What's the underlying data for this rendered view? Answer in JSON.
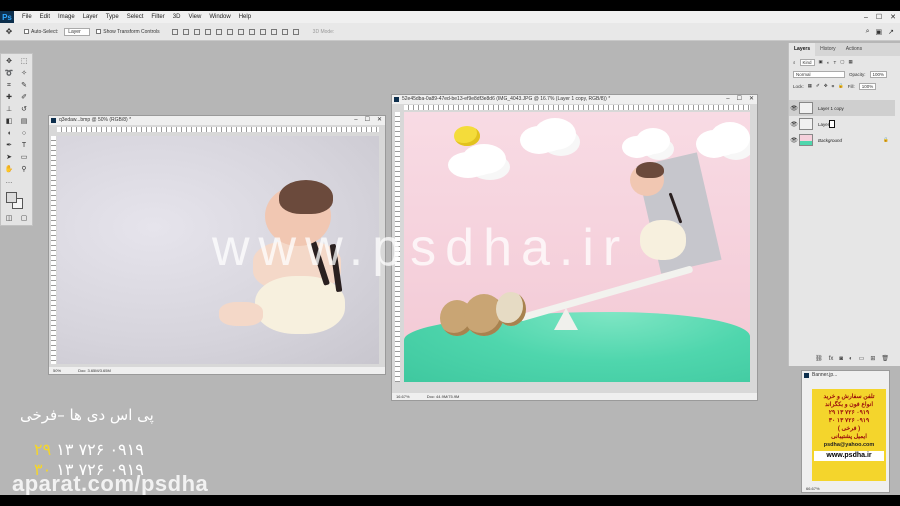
{
  "app": {
    "logo": "Ps",
    "menu": [
      "File",
      "Edit",
      "Image",
      "Layer",
      "Type",
      "Select",
      "Filter",
      "3D",
      "View",
      "Window",
      "Help"
    ],
    "window_controls": [
      "–",
      "☐",
      "✕"
    ]
  },
  "options": {
    "auto_select_label": "Auto-Select:",
    "auto_select_value": "Layer",
    "transform_label": "Show Transform Controls",
    "mode3d_label": "3D Mode:"
  },
  "doc1": {
    "title": "q3edaw...bmp @ 50% (RGB/8) *",
    "zoom": "50%",
    "doc_size": "Doc: 3.65M/3.65M",
    "buttons": [
      "–",
      "☐",
      "✕"
    ]
  },
  "doc2": {
    "title": "52e45dba-0a89-47ed-be13-ef9e8df3e8d6 (IMG_4043.JPG @ 16.7% (Layer 1 copy, RGB/8)) *",
    "zoom": "16.67%",
    "doc_size": "Doc: 44.9M/75.9M",
    "buttons": [
      "–",
      "☐",
      "✕"
    ],
    "ruler_v": [
      "0",
      "1",
      "2",
      "3",
      "4",
      "5",
      "6",
      "7",
      "8",
      "9",
      "10",
      "11",
      "12",
      "13",
      "14",
      "15",
      "16",
      "17",
      "18"
    ]
  },
  "watermark": "www.psdha.ir",
  "layers_panel": {
    "tabs": [
      "Layers",
      "History",
      "Actions"
    ],
    "kind_label": "Kind",
    "blend_mode": "Normal",
    "opacity_label": "Opacity:",
    "opacity_value": "100%",
    "lock_label": "Lock:",
    "fill_label": "Fill:",
    "fill_value": "100%",
    "layers": [
      {
        "name": "Layer 1 copy",
        "selected": true
      },
      {
        "name": "Layer 1",
        "selected": false
      },
      {
        "name": "Background",
        "selected": false
      }
    ],
    "footer_icons": [
      "fx",
      "link-icon",
      "mask-icon",
      "adjust-icon",
      "folder-icon",
      "new-layer-icon",
      "trash-icon"
    ]
  },
  "banner": {
    "title": "Banner.jp...",
    "zoom": "66.67%",
    "lines": [
      "تلفن سفارش و خرید",
      "انواع فون و بکگراند",
      "۰۹۱۹ ۷۲۶ ۱۳ ۲۹",
      "۰۹۱۹ ۷۲۶ ۱۳ ۳۰",
      "( فرخی )",
      "ایمیل پشتیبانی"
    ],
    "email": "psdha@yahoo.com",
    "site": "www.psdha.ir"
  },
  "overlay": {
    "name": "پی اس دی ها –فرخی",
    "phone1_main": "۰۹۱۹ ۷۲۶ ۱۳ ",
    "phone1_end": "۲۹",
    "phone2_main": "۰۹۱۹ ۷۲۶ ۱۳ ",
    "phone2_end": "۳۰",
    "aparat": "aparat.com/psdha"
  },
  "colors": {
    "accent_yellow": "#f4d52c",
    "ps_blue": "#31a8ff",
    "hill_green": "#4fd6ad",
    "bg_pink": "#f5d0db"
  }
}
